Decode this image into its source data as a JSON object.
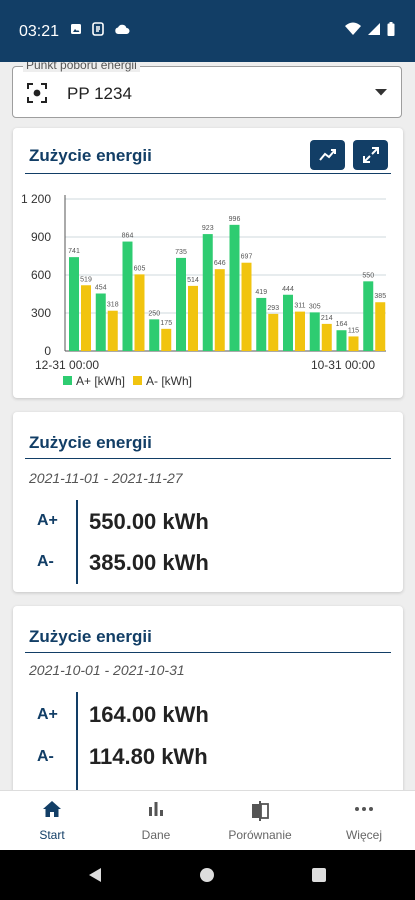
{
  "status": {
    "time": "03:21"
  },
  "meter": {
    "label": "Punkt poboru energii",
    "value": "PP 1234"
  },
  "chart_card": {
    "title": "Zużycie energii"
  },
  "chart_data": {
    "type": "bar",
    "categories": [
      "",
      "",
      "",
      "",
      "",
      "",
      "",
      "",
      "",
      "",
      "",
      "",
      "",
      ""
    ],
    "series": [
      {
        "name": "A+ [kWh]",
        "color": "#2ecc71",
        "values": [
          741,
          454,
          864,
          250,
          735,
          923,
          996,
          419,
          444,
          305,
          164,
          550
        ]
      },
      {
        "name": "A- [kWh]",
        "color": "#f1c40f",
        "values": [
          519,
          318,
          605,
          175,
          514,
          646,
          697,
          293,
          311,
          214,
          115,
          385
        ]
      }
    ],
    "bar_labels_plus": [
      "741",
      "454",
      "864",
      "250",
      "735",
      "923",
      "996",
      "419",
      "444",
      "305",
      "164",
      "550"
    ],
    "bar_labels_minus": [
      "519",
      "318",
      "605",
      "175",
      "514",
      "646",
      "697",
      "293",
      "311",
      "214",
      "115",
      "385"
    ],
    "ylim": [
      0,
      1200
    ],
    "yticks": [
      "0",
      "300",
      "600",
      "900",
      "1 200"
    ],
    "x_start_label": "12-31 00:00",
    "x_end_label": "10-31 00:00",
    "legend": [
      "A+ [kWh]",
      "A- [kWh]"
    ]
  },
  "summary1": {
    "title": "Zużycie energii",
    "dates": "2021-11-01 - 2021-11-27",
    "plus_label": "A+",
    "plus_value": "550.00 kWh",
    "minus_label": "A-",
    "minus_value": "385.00 kWh"
  },
  "summary2": {
    "title": "Zużycie energii",
    "dates": "2021-10-01 - 2021-10-31",
    "plus_label": "A+",
    "plus_value": "164.00 kWh",
    "minus_label": "A-",
    "minus_value": "114.80 kWh"
  },
  "nav": [
    {
      "label": "Start",
      "icon": "home-icon"
    },
    {
      "label": "Dane",
      "icon": "bar-chart-icon"
    },
    {
      "label": "Porównanie",
      "icon": "compare-icon"
    },
    {
      "label": "Więcej",
      "icon": "more-icon"
    }
  ],
  "colors": {
    "primary": "#123e66",
    "green": "#2ecc71",
    "yellow": "#f1c40f"
  }
}
